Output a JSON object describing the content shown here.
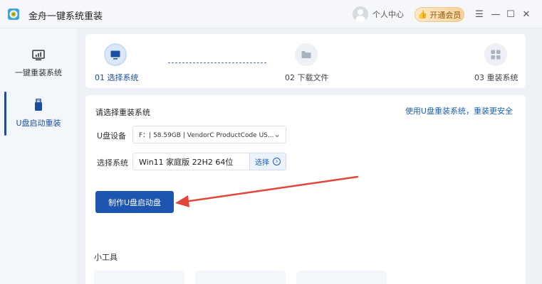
{
  "window": {
    "title": "金舟一键系统重装",
    "user_label": "个人中心",
    "vip_label": "开通会员"
  },
  "sidebar": {
    "items": [
      {
        "label": "一键重装系统",
        "icon": "monitor-chart-icon"
      },
      {
        "label": "U盘启动重装",
        "icon": "usb-drive-icon"
      }
    ]
  },
  "steps": [
    {
      "label": "01 选择系统",
      "icon": "monitor-icon"
    },
    {
      "label": "02 下载文件",
      "icon": "folder-icon"
    },
    {
      "label": "03 重装系统",
      "icon": "grid-icon"
    }
  ],
  "main": {
    "section_title": "请选择重装系统",
    "help_link": "使用U盘重装系统，重装更安全",
    "usb_label": "U盘设备",
    "usb_value": "F：| 58.59GB | VendorC ProductCode US...",
    "os_label": "选择系统",
    "os_value": "Win11 家庭版 22H2 64位",
    "os_pick_label": "选择",
    "make_button": "制作U盘启动盘",
    "tools_title": "小工具"
  },
  "colors": {
    "primary": "#1d55b0",
    "link": "#1a5fb4",
    "arrow": "#e0463a",
    "vip_gold": "#f7d29a"
  }
}
